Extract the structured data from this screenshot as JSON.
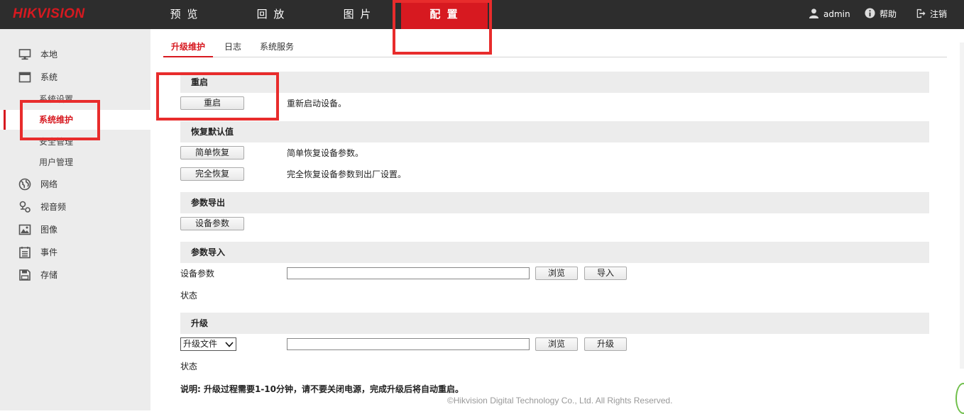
{
  "brand": {
    "logo": "HIKVISION",
    "accent": "#d71920"
  },
  "topnav": {
    "items": [
      {
        "label": "预 览",
        "active": false
      },
      {
        "label": "回 放",
        "active": false
      },
      {
        "label": "图 片",
        "active": false
      },
      {
        "label": "配 置",
        "active": true
      }
    ],
    "user": "admin",
    "help": "帮助",
    "logout": "注销"
  },
  "sidebar": {
    "local": "本地",
    "system": "系统",
    "system_settings": "系统设置",
    "system_maintenance": "系统维护",
    "security": "安全管理",
    "user_mgmt": "用户管理",
    "network": "网络",
    "video_audio": "视音频",
    "image": "图像",
    "event": "事件",
    "storage": "存储"
  },
  "tabs": [
    "升级维护",
    "日志",
    "系统服务"
  ],
  "reboot": {
    "title": "重启",
    "button": "重启",
    "desc": "重新启动设备。"
  },
  "restore": {
    "title": "恢复默认值",
    "simple_button": "简单恢复",
    "simple_desc": "简单恢复设备参数。",
    "full_button": "完全恢复",
    "full_desc": "完全恢复设备参数到出厂设置。"
  },
  "export": {
    "title": "参数导出",
    "button": "设备参数"
  },
  "import": {
    "title": "参数导入",
    "label": "设备参数",
    "file_value": "",
    "browse": "浏览",
    "import_button": "导入",
    "status_label": "状态"
  },
  "upgrade": {
    "title": "升级",
    "select_value": "升级文件",
    "file_value": "",
    "browse": "浏览",
    "upgrade_button": "升级",
    "status_label": "状态",
    "note": "说明: 升级过程需要1-10分钟，请不要关闭电源，完成升级后将自动重启。"
  },
  "footer": "©Hikvision Digital Technology Co., Ltd. All Rights Reserved."
}
